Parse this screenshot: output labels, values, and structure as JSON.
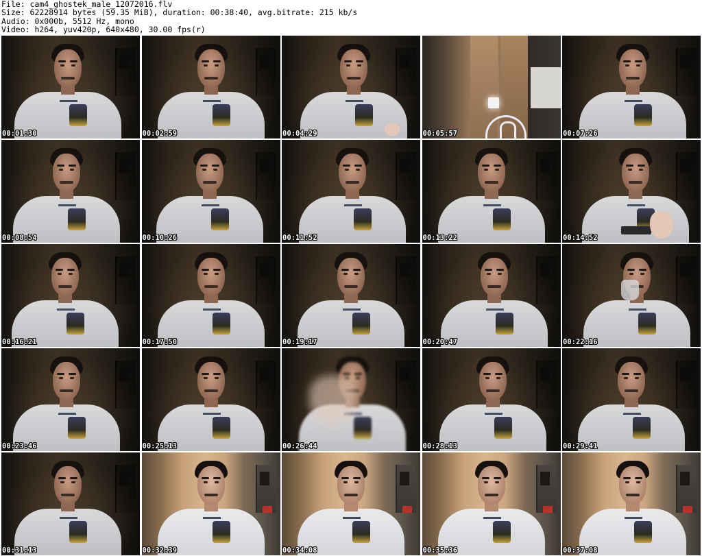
{
  "header": {
    "file_line": "File: cam4_ghostek_male_12072016.flv",
    "size_line": "Size: 62228914 bytes (59.35 MiB), duration: 00:38:40, avg.bitrate: 215 kb/s",
    "audio_line": "Audio: 0x000b, 5512 Hz, mono",
    "video_line": "Video: h264, yuv420p, 640x480, 30.00 fps(r)"
  },
  "thumbnails": [
    {
      "timestamp": "00:01:30",
      "scene": "dark"
    },
    {
      "timestamp": "00:02:59",
      "scene": "dark"
    },
    {
      "timestamp": "00:04:29",
      "scene": "dark-hand"
    },
    {
      "timestamp": "00:05:57",
      "scene": "room"
    },
    {
      "timestamp": "00:07:26",
      "scene": "dark"
    },
    {
      "timestamp": "00:08:54",
      "scene": "dark"
    },
    {
      "timestamp": "00:10:26",
      "scene": "dark"
    },
    {
      "timestamp": "00:11:52",
      "scene": "dark"
    },
    {
      "timestamp": "00:13:22",
      "scene": "dark"
    },
    {
      "timestamp": "00:14:52",
      "scene": "dark-device"
    },
    {
      "timestamp": "00:16:21",
      "scene": "dark"
    },
    {
      "timestamp": "00:17:50",
      "scene": "dark"
    },
    {
      "timestamp": "00:19:17",
      "scene": "dark"
    },
    {
      "timestamp": "00:20:47",
      "scene": "dark"
    },
    {
      "timestamp": "00:22:16",
      "scene": "dark-cup"
    },
    {
      "timestamp": "00:23:46",
      "scene": "dark"
    },
    {
      "timestamp": "00:25:13",
      "scene": "dark"
    },
    {
      "timestamp": "00:26:44",
      "scene": "dark-motion"
    },
    {
      "timestamp": "00:28:13",
      "scene": "dark"
    },
    {
      "timestamp": "00:29:41",
      "scene": "dark"
    },
    {
      "timestamp": "00:31:13",
      "scene": "dark"
    },
    {
      "timestamp": "00:32:39",
      "scene": "bright"
    },
    {
      "timestamp": "00:34:08",
      "scene": "bright"
    },
    {
      "timestamp": "00:35:36",
      "scene": "bright"
    },
    {
      "timestamp": "00:37:08",
      "scene": "bright"
    }
  ]
}
